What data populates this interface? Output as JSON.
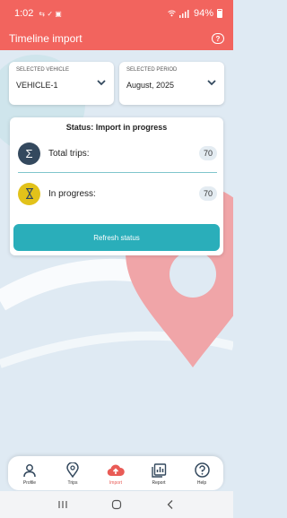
{
  "statusbar": {
    "time": "1:02",
    "notif_icons": "⇆ ✓ ▣",
    "battery": "94%"
  },
  "appbar": {
    "title": "Timeline import"
  },
  "selectors": {
    "vehicle": {
      "label": "SELECTED VEHICLE",
      "value": "VEHICLE-1"
    },
    "period": {
      "label": "SELECTED PERIOD",
      "value": "August, 2025"
    }
  },
  "status_card": {
    "title": "Status: Import in progress",
    "total_trips_label": "Total trips:",
    "total_trips_value": "70",
    "in_progress_label": "In progress:",
    "in_progress_value": "70",
    "refresh_label": "Refresh status"
  },
  "bottom_nav": {
    "items": [
      {
        "label": "Profile",
        "icon": "person-icon"
      },
      {
        "label": "Trips",
        "icon": "location-pin-icon"
      },
      {
        "label": "Import",
        "icon": "cloud-upload-icon",
        "active": true
      },
      {
        "label": "Report",
        "icon": "report-icon"
      },
      {
        "label": "Help",
        "icon": "help-icon"
      }
    ]
  },
  "colors": {
    "header": "#f2645e",
    "accent": "#2aaeba",
    "sigma_circle": "#34495e",
    "hourglass_circle": "#e2c21a",
    "active_nav": "#e95b56"
  }
}
